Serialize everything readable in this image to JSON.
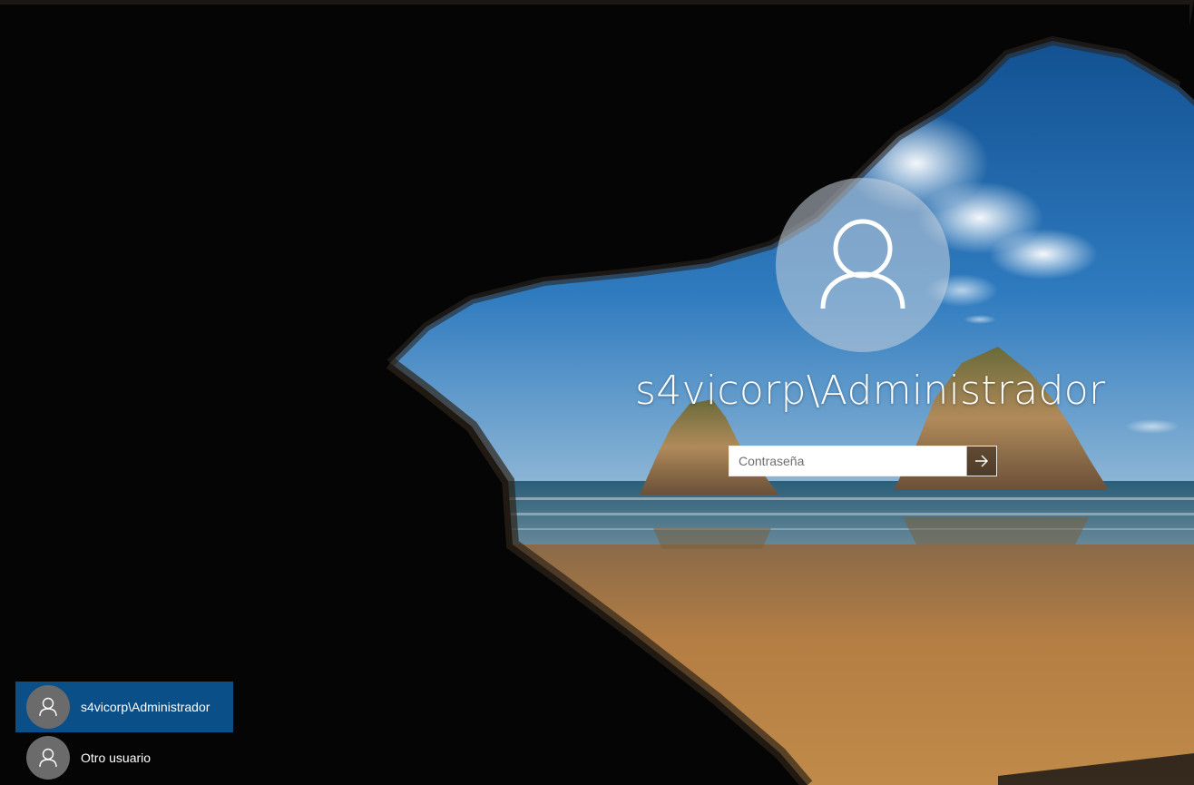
{
  "login": {
    "username": "s4vicorp\\Administrador",
    "password_value": "",
    "password_placeholder": "Contraseña",
    "submit_icon": "arrow-right-icon",
    "avatar_icon": "user-icon"
  },
  "user_list": {
    "items": [
      {
        "label": "s4vicorp\\Administrador",
        "selected": true,
        "icon": "user-icon"
      },
      {
        "label": "Otro usuario",
        "selected": false,
        "icon": "user-icon"
      }
    ]
  },
  "colors": {
    "selected_user_bg": "#0b4f88",
    "sky": "#1e5f9e",
    "sand": "#b07a3e",
    "cave": "#050505"
  }
}
